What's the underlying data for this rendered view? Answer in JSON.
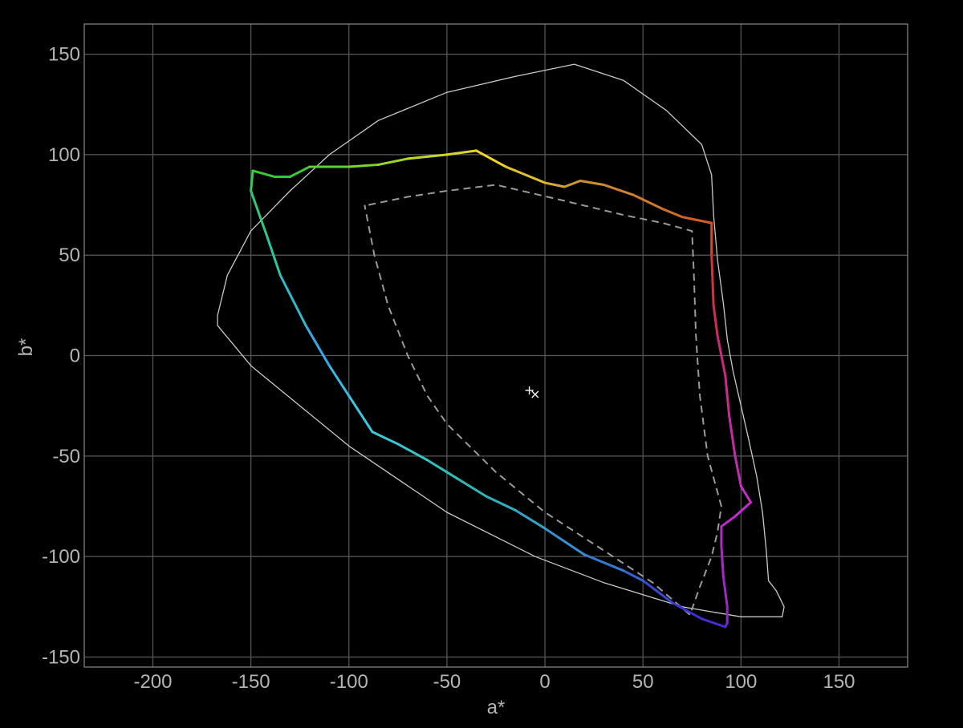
{
  "chart_data": {
    "type": "line",
    "title": "",
    "xlabel": "a*",
    "ylabel": "b*",
    "xlim": [
      -235,
      185
    ],
    "ylim": [
      -155,
      165
    ],
    "grid": true,
    "x_ticks": [
      -200,
      -150,
      -100,
      -50,
      0,
      50,
      100,
      150
    ],
    "y_ticks": [
      -150,
      -100,
      -50,
      0,
      50,
      100,
      150
    ],
    "x_tick_labels": [
      "-200",
      "-150",
      "-100",
      "-50",
      "0",
      "50",
      "100",
      "150"
    ],
    "y_tick_labels": [
      "-150",
      "-100",
      "-50",
      "0",
      "50",
      "100",
      "150"
    ],
    "colors": {
      "background": "#000000",
      "grid": "#5a5a5a",
      "text": "#b4b4b4",
      "outer_gamut": "#c8c8c8",
      "reference_gamut": "#9a9a9a"
    },
    "series": [
      {
        "style": "solid-thin-white",
        "points": [
          [
            -167,
            20
          ],
          [
            -162,
            40
          ],
          [
            -150,
            62
          ],
          [
            -130,
            82
          ],
          [
            -110,
            100
          ],
          [
            -85,
            117
          ],
          [
            -50,
            131
          ],
          [
            -15,
            139
          ],
          [
            15,
            145
          ],
          [
            40,
            137
          ],
          [
            62,
            122
          ],
          [
            80,
            105
          ],
          [
            85,
            90
          ],
          [
            86,
            70
          ],
          [
            88,
            48
          ],
          [
            91,
            26
          ],
          [
            93,
            8
          ],
          [
            96,
            -8
          ],
          [
            100,
            -25
          ],
          [
            104,
            -42
          ],
          [
            108,
            -60
          ],
          [
            111,
            -78
          ],
          [
            113,
            -98
          ],
          [
            114,
            -112
          ],
          [
            118,
            -117
          ],
          [
            122,
            -125
          ],
          [
            121,
            -130
          ],
          [
            100,
            -130
          ],
          [
            70,
            -125
          ],
          [
            30,
            -113
          ],
          [
            -5,
            -100
          ],
          [
            -50,
            -78
          ],
          [
            -100,
            -45
          ],
          [
            -150,
            -5
          ],
          [
            -167,
            15
          ],
          [
            -167,
            20
          ]
        ]
      },
      {
        "style": "dashed-gray",
        "points": [
          [
            -90,
            75
          ],
          [
            -70,
            79
          ],
          [
            -50,
            82
          ],
          [
            -25,
            85
          ],
          [
            10,
            77
          ],
          [
            40,
            70
          ],
          [
            60,
            66
          ],
          [
            75,
            62
          ],
          [
            76,
            40
          ],
          [
            77,
            10
          ],
          [
            79,
            -20
          ],
          [
            83,
            -50
          ],
          [
            90,
            -75
          ],
          [
            88,
            -88
          ],
          [
            85,
            -100
          ],
          [
            79,
            -115
          ],
          [
            74,
            -129
          ],
          [
            55,
            -113
          ],
          [
            30,
            -97
          ],
          [
            0,
            -78
          ],
          [
            -25,
            -58
          ],
          [
            -50,
            -34
          ],
          [
            -60,
            -20
          ],
          [
            -70,
            0
          ],
          [
            -80,
            25
          ],
          [
            -87,
            50
          ],
          [
            -92,
            75
          ]
        ]
      },
      {
        "style": "spectral-locus",
        "points": [
          [
            -149,
            92
          ],
          [
            -138,
            89
          ],
          [
            -130,
            89
          ],
          [
            -120,
            94
          ],
          [
            -100,
            94
          ],
          [
            -85,
            95
          ],
          [
            -70,
            98
          ],
          [
            -50,
            100
          ],
          [
            -35,
            102
          ],
          [
            -20,
            94
          ],
          [
            0,
            86
          ],
          [
            10,
            84
          ],
          [
            18,
            87
          ],
          [
            30,
            85
          ],
          [
            45,
            80
          ],
          [
            60,
            73
          ],
          [
            70,
            69
          ],
          [
            85,
            66
          ],
          [
            85,
            50
          ],
          [
            86,
            25
          ],
          [
            88,
            10
          ],
          [
            92,
            -10
          ],
          [
            94,
            -30
          ],
          [
            97,
            -50
          ],
          [
            100,
            -65
          ],
          [
            105,
            -73
          ],
          [
            97,
            -80
          ],
          [
            90,
            -85
          ],
          [
            90,
            -95
          ],
          [
            91,
            -110
          ],
          [
            93,
            -125
          ],
          [
            93,
            -133
          ],
          [
            92,
            -135
          ],
          [
            80,
            -131
          ],
          [
            65,
            -123
          ],
          [
            50,
            -112
          ],
          [
            40,
            -107
          ],
          [
            20,
            -99
          ],
          [
            0,
            -86
          ],
          [
            -15,
            -77
          ],
          [
            -30,
            -70
          ],
          [
            -45,
            -61
          ],
          [
            -60,
            -52
          ],
          [
            -75,
            -44
          ],
          [
            -88,
            -38
          ],
          [
            -100,
            -20
          ],
          [
            -110,
            -5
          ],
          [
            -122,
            15
          ],
          [
            -135,
            40
          ],
          [
            -142,
            60
          ],
          [
            -150,
            82
          ],
          [
            -149,
            92
          ]
        ],
        "colors": [
          "#33cc33",
          "#2fc838",
          "#3bc938",
          "#5ccf33",
          "#7ed42f",
          "#9dd62b",
          "#c5d72a",
          "#ddd628",
          "#f0d62a",
          "#e3c12a",
          "#d9a82e",
          "#d3972f",
          "#cf8e30",
          "#d3842f",
          "#d17a2c",
          "#d06b28",
          "#d35c28",
          "#d84a28",
          "#da3038",
          "#d22a55",
          "#cc2a78",
          "#c82a90",
          "#c62aa6",
          "#c42ab8",
          "#c72ac8",
          "#c82ad0",
          "#c02ad0",
          "#b52acb",
          "#a82ac5",
          "#9a2abf",
          "#8a2abb",
          "#6b2ac6",
          "#4b2ad0",
          "#3a32d2",
          "#3748d6",
          "#3562d6",
          "#347ad4",
          "#3390d0",
          "#31a3c8",
          "#2eb1be",
          "#30b6b2",
          "#31bfbb",
          "#34c6c8",
          "#37cad5",
          "#3ac7e0",
          "#3ab8e6",
          "#37a8e6",
          "#2fb8c8",
          "#2cc4a2",
          "#2ec97a",
          "#31cc55",
          "#33cc33"
        ]
      }
    ],
    "markers": [
      {
        "symbol": "+",
        "a": -8,
        "b": -17
      },
      {
        "symbol": "×",
        "a": -5,
        "b": -19
      }
    ]
  }
}
